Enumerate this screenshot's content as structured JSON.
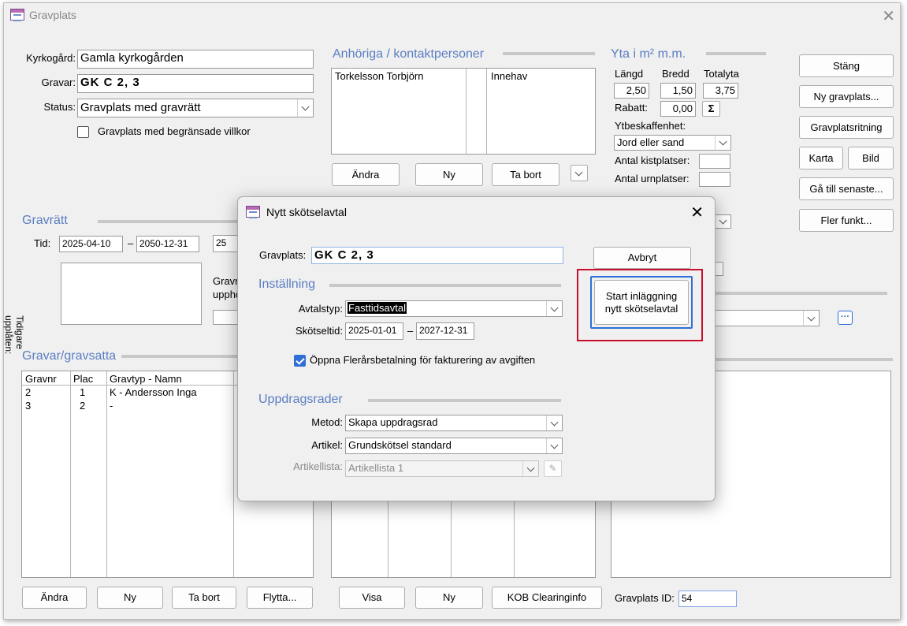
{
  "window": {
    "title": "Gravplats",
    "close_icon": "close-icon"
  },
  "top": {
    "kyrkogard_label": "Kyrkogård:",
    "kyrkogard_value": "Gamla kyrkogården",
    "gravar_label": "Gravar:",
    "gravar_value": "GK C    2, 3",
    "status_label": "Status:",
    "status_value": "Gravplats med gravrätt",
    "restricted_label": "Gravplats med begränsade villkor"
  },
  "contacts": {
    "heading": "Anhöriga / kontaktpersoner",
    "rows": [
      {
        "name": "Torkelsson Torbjörn",
        "role": "Innehav"
      }
    ],
    "andra_label": "Ändra",
    "ny_label": "Ny",
    "ta_bort_label": "Ta bort"
  },
  "yta": {
    "heading": "Yta i m²  m.m.",
    "langd_label": "Längd",
    "bredd_label": "Bredd",
    "totalyta_label": "Totalyta",
    "langd_value": "2,50",
    "bredd_value": "1,50",
    "totalyta_value": "3,75",
    "rabatt_label": "Rabatt:",
    "rabatt_value": "0,00",
    "sigma": "Σ",
    "ytbeskaffenhet_label": "Ytbeskaffenhet:",
    "ytbeskaffenhet_value": "Jord eller sand",
    "kistplatser_label": "Antal kistplatser:",
    "urnplatser_label": "Antal urnplatser:"
  },
  "side_buttons": {
    "stang": "Stäng",
    "ny_gravplats": "Ny gravplats...",
    "gravplatsritning": "Gravplatsritning",
    "karta": "Karta",
    "bild": "Bild",
    "ga_till_senaste": "Gå till senaste...",
    "fler_funkt": "Fler funkt..."
  },
  "gravratt": {
    "heading": "Gravrätt",
    "tid_label": "Tid:",
    "from": "2025-04-10",
    "dash": "–",
    "to": "2050-12-31",
    "years": "25",
    "tidigare_label": "Tidigare upplåten:",
    "gravr_label": "Gravr",
    "upph_label": "upphö"
  },
  "gravar": {
    "heading": "Gravar/gravsatta",
    "columns": [
      "Gravnr",
      "Plac",
      "Gravtyp - Namn"
    ],
    "rows": [
      {
        "gravnr": "2",
        "plac": "1",
        "namn": "K - Andersson Inga"
      },
      {
        "gravnr": "3",
        "plac": "2",
        "namn": " -"
      }
    ],
    "andra_label": "Ändra",
    "ny_label": "Ny",
    "ta_bort_label": "Ta bort",
    "flytta_label": "Flytta..."
  },
  "bottom": {
    "visa_label": "Visa",
    "ny_label": "Ny",
    "kob_label": "KOB Clearinginfo",
    "gravplats_id_label": "Gravplats ID:",
    "gravplats_id_value": "54"
  },
  "dialog": {
    "title": "Nytt skötselavtal",
    "gravplats_label": "Gravplats:",
    "gravplats_value": "GK C    2, 3",
    "installning_heading": "Inställning",
    "avtalstyp_label": "Avtalstyp:",
    "avtalstyp_value": "Fasttidsavtal",
    "skotseltid_label": "Skötseltid:",
    "skotsel_from": "2025-01-01",
    "skotsel_dash": "–",
    "skotsel_to": "2027-12-31",
    "oppna_label": "Öppna Flerårsbetalning för fakturering av avgiften",
    "oppna_checked": true,
    "uppdrag_heading": "Uppdragsrader",
    "metod_label": "Metod:",
    "metod_value": "Skapa uppdragsrad",
    "artikel_label": "Artikel:",
    "artikel_value": "Grundskötsel standard",
    "artikellista_label": "Artikellista:",
    "artikellista_value": "Artikellista 1",
    "avbryt_label": "Avbryt",
    "start_line1": "Start inläggning",
    "start_line2": "nytt skötselavtal",
    "highlight_color": "#c8102e",
    "focus_color": "#2f6fd6"
  }
}
